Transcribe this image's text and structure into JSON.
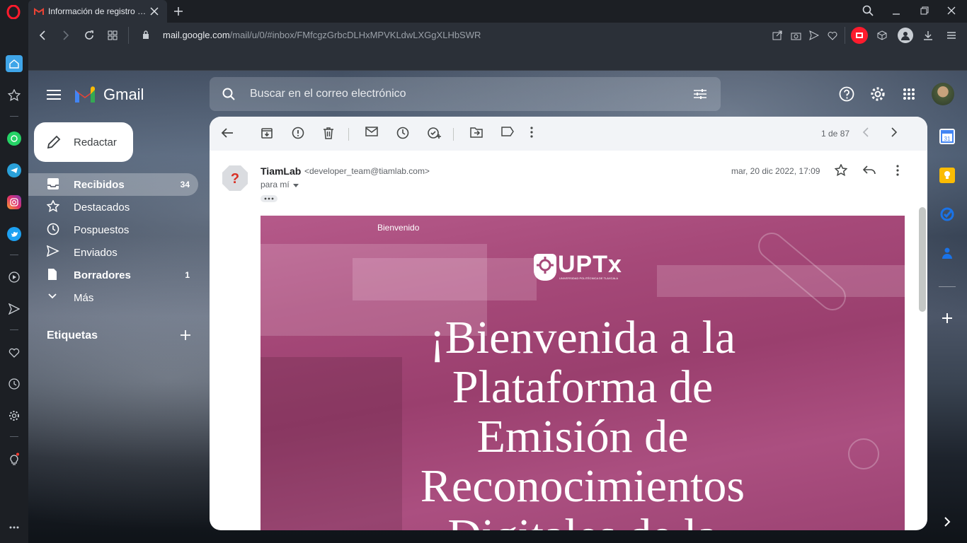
{
  "browser": {
    "tab_title": "Información de registro a la",
    "url_domain": "mail.google.com",
    "url_path": "/mail/u/0/#inbox/FMfcgzGrbcDLHxMPVKLdwLXGgXLHbSWR"
  },
  "gmail": {
    "app_name": "Gmail",
    "compose": "Redactar",
    "search_placeholder": "Buscar en el correo electrónico",
    "nav": [
      {
        "label": "Recibidos",
        "count": "34"
      },
      {
        "label": "Destacados",
        "count": ""
      },
      {
        "label": "Pospuestos",
        "count": ""
      },
      {
        "label": "Enviados",
        "count": ""
      },
      {
        "label": "Borradores",
        "count": "1"
      },
      {
        "label": "Más",
        "count": ""
      }
    ],
    "labels_heading": "Etiquetas"
  },
  "message": {
    "pagination": "1 de 87",
    "sender_name": "TiamLab",
    "sender_email": "<developer_team@tiamlab.com>",
    "date": "mar, 20 dic 2022, 17:09",
    "recipient": "para mí",
    "banner": {
      "small_text": "Bienvenido",
      "logo_text": "UPTx",
      "logo_sub": "UNIVERSIDAD POLITÉCNICA DE TLAXCALA",
      "headline": [
        "¡Bienvenida a la",
        "Plataforma de",
        "Emisión de",
        "Reconocimientos",
        "Digitales de la"
      ]
    }
  },
  "colors": {
    "banner_tint": "#a64979",
    "gmail_red": "#ea4335",
    "opera_red": "#ff1b2d"
  }
}
